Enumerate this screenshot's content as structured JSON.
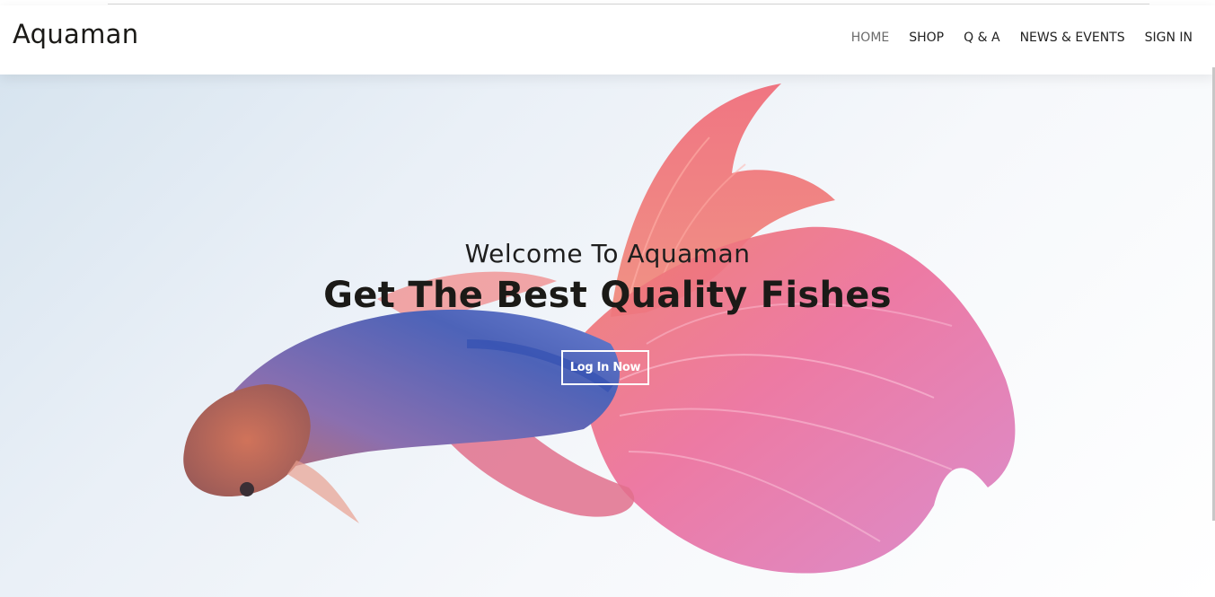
{
  "brand": {
    "name": "Aquaman"
  },
  "nav": {
    "items": [
      {
        "label": "HOME",
        "active": true
      },
      {
        "label": "SHOP",
        "active": false
      },
      {
        "label": "Q & A",
        "active": false
      },
      {
        "label": "NEWS & EVENTS",
        "active": false
      },
      {
        "label": "SIGN IN",
        "active": false
      }
    ]
  },
  "hero": {
    "welcome": "Welcome To Aquaman",
    "headline": "Get The Best Quality Fishes",
    "cta_label": "Log In Now",
    "image": "betta-fish-photo"
  },
  "colors": {
    "text_dark": "#1b1a17",
    "nav_active": "#6b6b6b",
    "fin_pink": "#e86a9a",
    "fin_orange": "#f08a6a",
    "body_blue": "#5a6fb8"
  }
}
